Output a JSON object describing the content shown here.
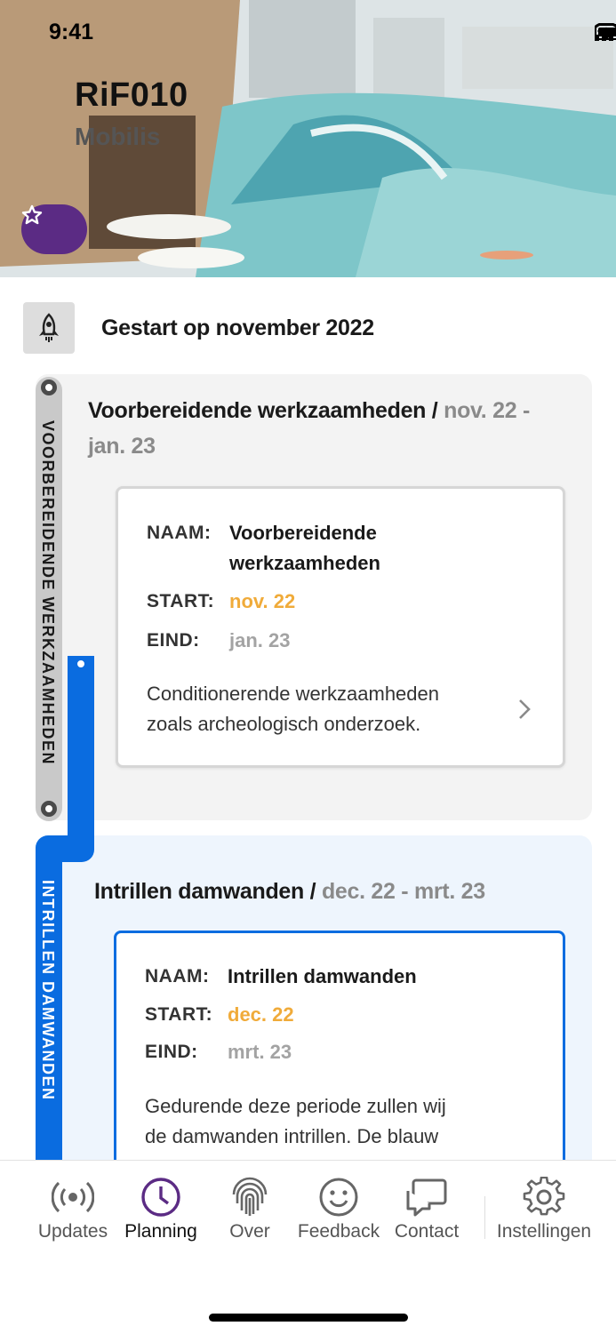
{
  "status_bar": {
    "time": "9:41"
  },
  "hero": {
    "title": "RiF010",
    "subtitle": "Mobilis",
    "favorite_icon": "star-icon"
  },
  "start": {
    "icon": "rocket-icon",
    "text": "Gestart op november 2022"
  },
  "phases": [
    {
      "vertical_label": "VOORBEREIDENDE WERKZAAMHEDEN",
      "title": "Voorbereidende werkzaamheden /",
      "dates_line1": "nov. 22 -",
      "dates_line2": "jan. 23",
      "detail": {
        "name_label": "NAAM:",
        "name_line1": "Voorbereidende",
        "name_line2": "werkzaamheden",
        "start_label": "START:",
        "start": "nov. 22",
        "end_label": "EIND:",
        "end": "jan. 23",
        "desc_line1": "Conditionerende werkzaamheden",
        "desc_line2": "zoals archeologisch onderzoek."
      }
    },
    {
      "vertical_label": "INTRILLEN DAMWANDEN",
      "title": "Intrillen damwanden /",
      "dates": "dec. 22 - mrt. 23",
      "detail": {
        "name_label": "NAAM:",
        "name": "Intrillen damwanden",
        "start_label": "START:",
        "start": "dec. 22",
        "end_label": "EIND:",
        "end": "mrt. 23",
        "desc_line1": "Gedurende deze periode zullen wij",
        "desc_line2": "de damwanden intrillen. De blauw"
      }
    }
  ],
  "colors": {
    "accent": "#5b2b84",
    "timeline_blue": "#0a6ce0",
    "start_orange": "#f0ab3a"
  },
  "tabs": [
    {
      "label": "Updates",
      "icon": "broadcast-icon"
    },
    {
      "label": "Planning",
      "icon": "clock-icon",
      "active": true
    },
    {
      "label": "Over",
      "icon": "fingerprint-icon"
    },
    {
      "label": "Feedback",
      "icon": "smiley-icon"
    },
    {
      "label": "Contact",
      "icon": "chat-icon"
    },
    {
      "label": "Instellingen",
      "icon": "gear-icon"
    }
  ]
}
